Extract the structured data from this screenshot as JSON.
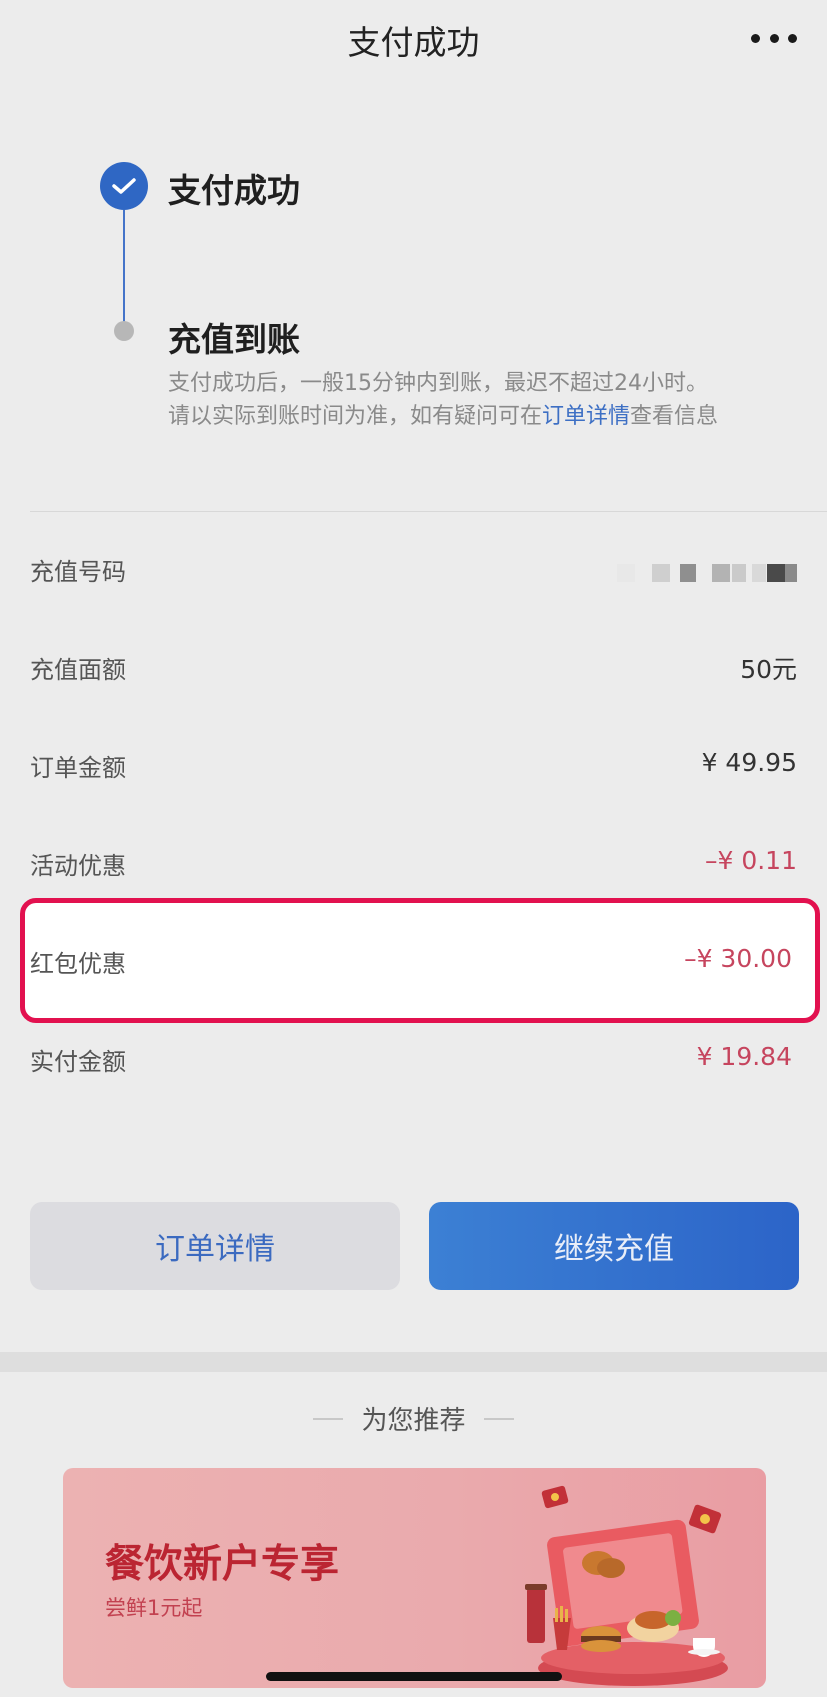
{
  "header": {
    "title": "支付成功"
  },
  "steps": [
    {
      "title": "支付成功"
    },
    {
      "title": "充值到账",
      "desc_line1": "支付成功后，一般15分钟内到账，最迟不超过24小时。",
      "desc_line2_prefix": "请以实际到账时间为准，如有疑问可在",
      "desc_link": "订单详情",
      "desc_line2_suffix": "查看信息"
    }
  ],
  "details": {
    "recharge_number_label": "充值号码",
    "recharge_amount_label": "充值面额",
    "recharge_amount_value": "50元",
    "order_amount_label": "订单金额",
    "order_amount_value": "¥ 49.95",
    "promo_label": "活动优惠",
    "promo_value": "–¥ 0.11",
    "redpacket_label": "红包优惠",
    "redpacket_value": "–¥ 30.00",
    "paid_label": "实付金额",
    "paid_value": "¥ 19.84"
  },
  "actions": {
    "order_detail": "订单详情",
    "continue": "继续充值"
  },
  "recommend": {
    "title": "为您推荐",
    "banner_title": "餐饮新户专享",
    "banner_subtitle": "尝鲜1元起"
  },
  "colors": {
    "accent_blue": "#2f67c4",
    "discount_red": "#c6455e",
    "highlight_border": "#e2114f"
  },
  "icons": [
    "more-icon",
    "check-icon",
    "food-promo-illustration"
  ]
}
